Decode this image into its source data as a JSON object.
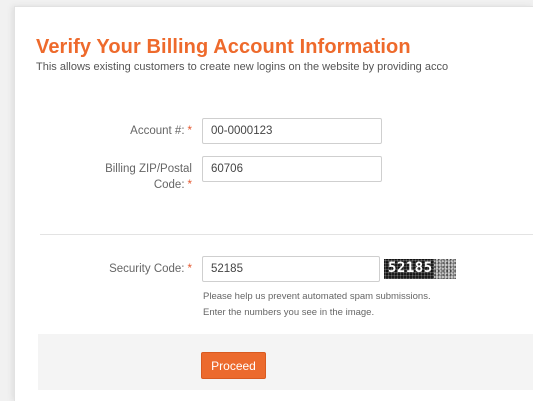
{
  "page": {
    "title": "Verify Your Billing Account Information",
    "subtitle": "This allows existing customers to create new logins on the website by providing acco"
  },
  "form": {
    "required_mark": "*",
    "account": {
      "label": "Account #:",
      "value": "00-0000123"
    },
    "zip": {
      "label_line1": "Billing ZIP/Postal",
      "label_line2": "Code:",
      "value": "60706"
    },
    "security": {
      "label": "Security Code:",
      "value": "52185",
      "captcha_text": "52185",
      "help_line1": "Please help us prevent automated spam submissions.",
      "help_line2": "Enter the numbers you see in the image."
    }
  },
  "actions": {
    "proceed_label": "Proceed"
  },
  "colors": {
    "accent": "#ee6a2c",
    "required": "#e4572e"
  }
}
